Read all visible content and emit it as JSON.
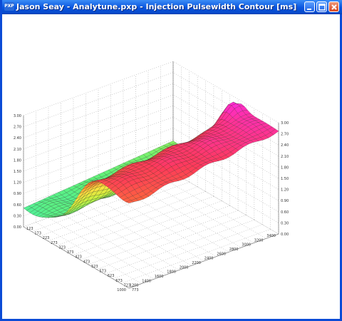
{
  "window": {
    "title": "Jason Seay - Analytune.pxp - Injection Pulsewidth Contour [ms]",
    "icon_label": "PXP",
    "controls": [
      "minimize-icon",
      "maximize-icon",
      "close-icon"
    ]
  },
  "colors": {
    "titlebar": "#0a56e0",
    "close": "#d9461d",
    "grid": "#9a9a9a",
    "mesh": "#222222"
  },
  "chart_data": {
    "type": "surface",
    "title": "",
    "z_ticks": [
      "0.00",
      "0.30",
      "0.60",
      "0.90",
      "1.20",
      "1.50",
      "1.80",
      "2.10",
      "2.40",
      "2.70",
      "3.00"
    ],
    "rpm_ticks": [
      "1000",
      "1200",
      "1400",
      "1600",
      "1800",
      "2000",
      "2200",
      "2400",
      "2600",
      "2800",
      "3000",
      "3200",
      "3400"
    ],
    "load_ticks": [
      "123",
      "173",
      "223",
      "273",
      "323",
      "373",
      "423",
      "473",
      "523",
      "573",
      "623",
      "673",
      "723",
      "773"
    ],
    "zlim": [
      0,
      3
    ],
    "grid": true,
    "colormap": "rainbow: cyan (low) to magenta (high)"
  }
}
